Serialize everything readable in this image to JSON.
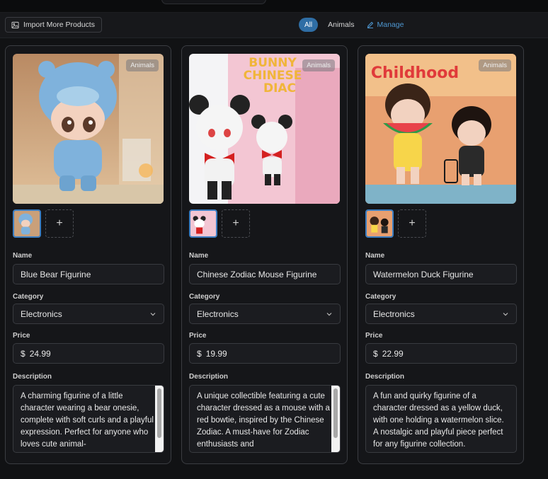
{
  "toolbar": {
    "import_label": "Import More Products",
    "filters": {
      "all": "All",
      "animals": "Animals",
      "manage": "Manage"
    }
  },
  "field_labels": {
    "name": "Name",
    "category": "Category",
    "price": "Price",
    "description": "Description"
  },
  "currency_symbol": "$",
  "add_symbol": "+",
  "colors": {
    "accent": "#2f6ea5",
    "link": "#4e97d1",
    "thumb_border": "#3b7fc4"
  },
  "products": [
    {
      "badge": "Animals",
      "name": "Blue Bear Figurine",
      "category": "Electronics",
      "price": "24.99",
      "description": "A charming figurine of a little character wearing a bear onesie, complete with soft curls and a playful expression. Perfect for anyone who loves cute animal-"
    },
    {
      "badge": "Animals",
      "box_text_1": "BUNNY",
      "box_text_2": "CHINESE",
      "box_text_3": "DIAC",
      "name": "Chinese Zodiac Mouse Figurine",
      "category": "Electronics",
      "price": "19.99",
      "description": "A unique collectible featuring a cute character dressed as a mouse with a red bowtie, inspired by the Chinese Zodiac. A must-have for Zodiac enthusiasts and"
    },
    {
      "badge": "Animals",
      "scene_text": "Childhood",
      "name": "Watermelon Duck Figurine",
      "category": "Electronics",
      "price": "22.99",
      "description": "A fun and quirky figurine of a character dressed as a yellow duck, with one holding a watermelon slice. A nostalgic and playful piece perfect for any figurine collection."
    }
  ]
}
